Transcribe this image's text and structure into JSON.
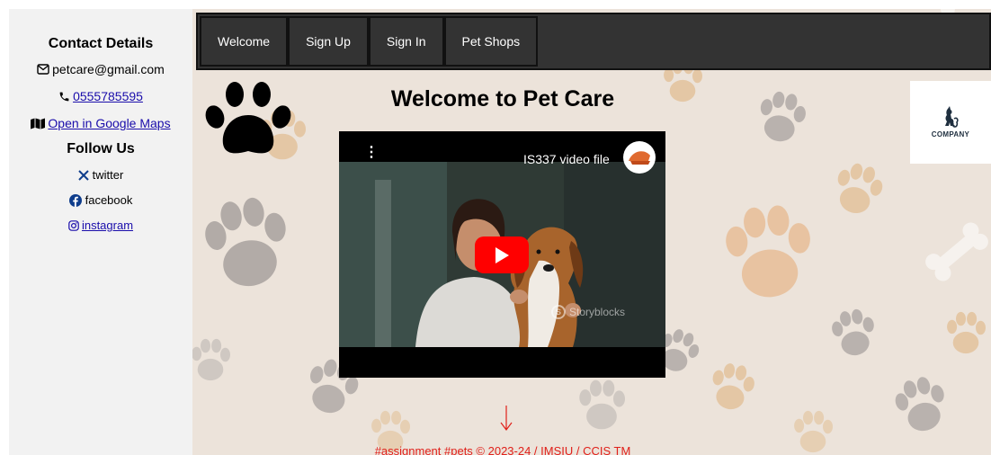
{
  "sidebar": {
    "contact_title": "Contact Details",
    "email": "petcare@gmail.com",
    "phone": "0555785595",
    "maps_link": "Open in Google Maps",
    "follow_title": "Follow Us",
    "social": {
      "twitter": "twitter",
      "facebook": "facebook",
      "instagram": "instagram"
    }
  },
  "nav": {
    "items": [
      "Welcome",
      "Sign Up",
      "Sign In",
      "Pet Shops"
    ]
  },
  "main": {
    "title": "Welcome to Pet Care",
    "video_title": "IS337 video file",
    "watermark": "Storyblocks",
    "company_logo_text": "COMPANY",
    "footer": "#assignment #pets © 2023-24 / IMSIU / CCIS TM"
  },
  "colors": {
    "sidebar_bg": "#f2f2f2",
    "navbar_bg": "#333333",
    "main_bg": "#ece3da",
    "footer_text": "#e0201a",
    "play_button": "#ff0000"
  },
  "icons": {
    "email": "envelope-icon",
    "phone": "phone-icon",
    "maps": "map-icon",
    "twitter": "x-logo-icon",
    "facebook": "facebook-icon",
    "instagram": "instagram-icon"
  }
}
